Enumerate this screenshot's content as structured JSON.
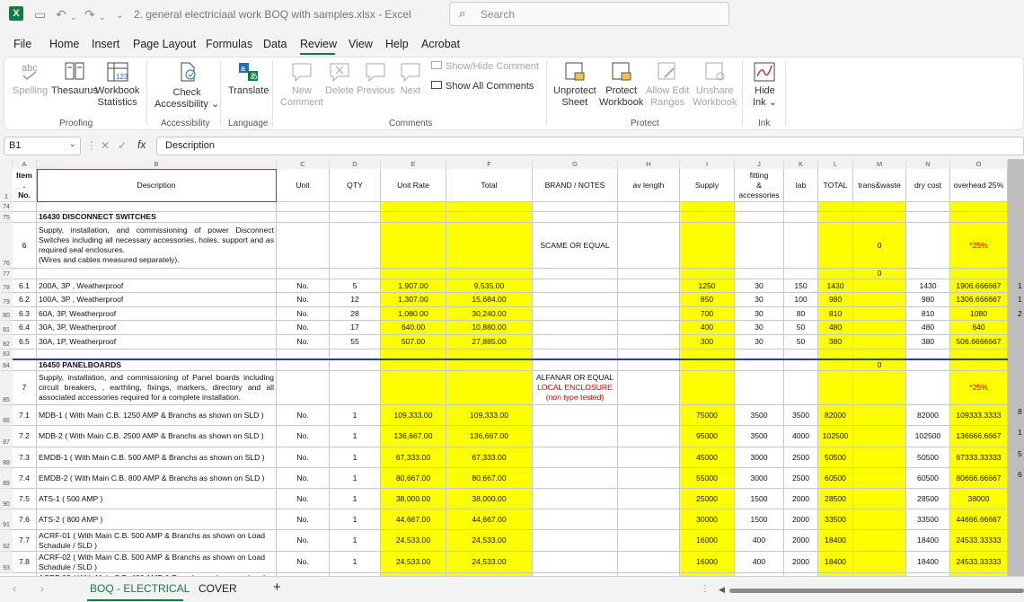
{
  "title": {
    "doc_name": "2. general electriciaal work BOQ with samples.xlsx  -  Excel",
    "search_placeholder": "Search"
  },
  "menu": [
    "File",
    "Home",
    "Insert",
    "Page Layout",
    "Formulas",
    "Data",
    "Review",
    "View",
    "Help",
    "Acrobat"
  ],
  "ribbon": {
    "spelling": "Spelling",
    "thesaurus": "Thesaurus",
    "workbook_stats": [
      "Workbook",
      "Statistics"
    ],
    "check_access": [
      "Check",
      "Accessibility ⌄"
    ],
    "translate": "Translate",
    "new_comment": [
      "New",
      "Comment"
    ],
    "delete": "Delete",
    "previous": "Previous",
    "next": "Next",
    "show_hide_comment": "Show/Hide Comment",
    "show_all_comments": "Show All Comments",
    "unprotect_sheet": [
      "Unprotect",
      "Sheet"
    ],
    "protect_workbook": [
      "Protect",
      "Workbook"
    ],
    "allow_edit_ranges": [
      "Allow Edit",
      "Ranges"
    ],
    "unshare_workbook": [
      "Unshare",
      "Workbook"
    ],
    "hide_ink": [
      "Hide",
      "Ink ⌄"
    ],
    "groups": {
      "proofing": "Proofing",
      "accessibility": "Accessibility",
      "language": "Language",
      "comments": "Comments",
      "protect": "Protect",
      "ink": "Ink"
    }
  },
  "formula_bar": {
    "name_box": "B1",
    "fx": "fx",
    "content": "Description"
  },
  "columns": [
    "A",
    "B",
    "C",
    "D",
    "E",
    "F",
    "G",
    "H",
    "I",
    "J",
    "K",
    "L",
    "M",
    "N",
    "O"
  ],
  "header": {
    "item": [
      "Item",
      ".",
      "No."
    ],
    "description": "Description",
    "unit": "Unit",
    "qty": "QTY",
    "unit_rate": "Unit Rate",
    "total": "Total",
    "brand": "BRAND / NOTES",
    "av_length": "av length",
    "supply": "Supply",
    "fitting": [
      "fitting",
      "&",
      "accessories"
    ],
    "lab": "lab",
    "total2": "TOTAL",
    "trans": "trans&waste",
    "dry_cost": "dry cost",
    "overhead": "overhead 25%"
  },
  "row_numbers": [
    "1",
    "74",
    "75",
    "76",
    "77",
    "78",
    "79",
    "80",
    "81",
    "82",
    "83",
    "84",
    "85",
    "86",
    "87",
    "88",
    "89",
    "90",
    "91",
    "92",
    "93"
  ],
  "sections": {
    "s1_title": "16430 DISCONNECT SWITCHES",
    "s1_item": "6",
    "s1_desc": "Supply, installation, and commissioning of power Disconnect Switches including all necessary accessories, holes, support and as required seal enclosures.",
    "s1_desc2": "(Wires and cables measured separately).",
    "s1_brand": "SCAME OR EQUAL",
    "s1_trans": "0",
    "s1_overhead": "*25%",
    "r77_trans": "0",
    "s2_title": "16450 PANELBOARDS",
    "s2_trans": "0",
    "s2_item": "7",
    "s2_desc": "Supply, installation, and commissioning of Panel boards including circuit breakers, , earthling, fixings, markers, directory and all associated accessories required for a complete installation.",
    "s2_brand1": "ALFANAR OR EQUAL",
    "s2_brand2": "LOCAL ENCLOSURE (non type tested)",
    "s2_overhead": "*25%"
  },
  "rows_a": [
    {
      "no": "6.1",
      "desc": "200A, 3P , Weatherproof",
      "unit": "No.",
      "qty": "5",
      "rate": "1,907.00",
      "total": "9,535.00",
      "supply": "1250",
      "fit": "30",
      "lab": "150",
      "tot": "1430",
      "dry": "1430",
      "oh": "1906.666667"
    },
    {
      "no": "6.2",
      "desc": "100A, 3P , Weatherproof",
      "unit": "No.",
      "qty": "12",
      "rate": "1,307.00",
      "total": "15,684.00",
      "supply": "850",
      "fit": "30",
      "lab": "100",
      "tot": "980",
      "dry": "980",
      "oh": "1306.666667"
    },
    {
      "no": "6.3",
      "desc": "60A, 3P, Weatherproof",
      "unit": "No.",
      "qty": "28",
      "rate": "1,080.00",
      "total": "30,240.00",
      "supply": "700",
      "fit": "30",
      "lab": "80",
      "tot": "810",
      "dry": "810",
      "oh": "1080"
    },
    {
      "no": "6.4",
      "desc": "30A, 3P, Weatherproof",
      "unit": "No.",
      "qty": "17",
      "rate": "640.00",
      "total": "10,880.00",
      "supply": "400",
      "fit": "30",
      "lab": "50",
      "tot": "480",
      "dry": "480",
      "oh": "640"
    },
    {
      "no": "6.5",
      "desc": "30A, 1P, Weatherproof",
      "unit": "No.",
      "qty": "55",
      "rate": "507.00",
      "total": "27,885.00",
      "supply": "300",
      "fit": "30",
      "lab": "50",
      "tot": "380",
      "dry": "380",
      "oh": "506.6666667"
    }
  ],
  "rows_b": [
    {
      "no": "7.1",
      "desc": "MDB-1 ( With Main C.B. 1250 AMP & Branchs as shown on SLD )",
      "unit": "No.",
      "qty": "1",
      "rate": "109,333.00",
      "total": "109,333.00",
      "supply": "75000",
      "fit": "3500",
      "lab": "3500",
      "tot": "82000",
      "dry": "82000",
      "oh": "109333.3333"
    },
    {
      "no": "7.2",
      "desc": "MDB-2 ( With Main C.B. 2500 AMP & Branchs as shown on SLD )",
      "unit": "No.",
      "qty": "1",
      "rate": "136,667.00",
      "total": "136,667.00",
      "supply": "95000",
      "fit": "3500",
      "lab": "4000",
      "tot": "102500",
      "dry": "102500",
      "oh": "136666.6667"
    },
    {
      "no": "7.3",
      "desc": "EMDB-1 ( With Main C.B. 500 AMP & Branchs as shown on SLD )",
      "unit": "No.",
      "qty": "1",
      "rate": "67,333.00",
      "total": "67,333.00",
      "supply": "45000",
      "fit": "3000",
      "lab": "2500",
      "tot": "50500",
      "dry": "50500",
      "oh": "67333.33333"
    },
    {
      "no": "7.4",
      "desc": "EMDB-2 ( With Main C.B. 800 AMP & Branchs as shown on SLD )",
      "unit": "No.",
      "qty": "1",
      "rate": "80,667.00",
      "total": "80,667.00",
      "supply": "55000",
      "fit": "3000",
      "lab": "2500",
      "tot": "60500",
      "dry": "60500",
      "oh": "80666.66667"
    },
    {
      "no": "7.5",
      "desc": "ATS-1 ( 500 AMP )",
      "unit": "No.",
      "qty": "1",
      "rate": "38,000.00",
      "total": "38,000.00",
      "supply": "25000",
      "fit": "1500",
      "lab": "2000",
      "tot": "28500",
      "dry": "28500",
      "oh": "38000"
    },
    {
      "no": "7.6",
      "desc": "ATS-2 ( 800 AMP )",
      "unit": "No.",
      "qty": "1",
      "rate": "44,667.00",
      "total": "44,667.00",
      "supply": "30000",
      "fit": "1500",
      "lab": "2000",
      "tot": "33500",
      "dry": "33500",
      "oh": "44666.66667"
    },
    {
      "no": "7.7",
      "desc": "ACRF-01 ( With Main C.B. 500 AMP & Branchs as shown on Load Schadule / SLD )",
      "unit": "No.",
      "qty": "1",
      "rate": "24,533.00",
      "total": "24,533.00",
      "supply": "16000",
      "fit": "400",
      "lab": "2000",
      "tot": "18400",
      "dry": "18400",
      "oh": "24533.33333"
    },
    {
      "no": "7.8",
      "desc": "ACRF-02 ( With Main C.B. 500 AMP & Branchs as shown on Load Schadule / SLD )",
      "unit": "No.",
      "qty": "1",
      "rate": "24,533.00",
      "total": "24,533.00",
      "supply": "16000",
      "fit": "400",
      "lab": "2000",
      "tot": "18400",
      "dry": "18400",
      "oh": "24533.33333"
    }
  ],
  "edge_digits": [
    "1",
    "1",
    "2",
    "",
    "",
    "8",
    "1",
    "5",
    "6",
    "",
    "",
    "",
    ""
  ],
  "partial_row": "ACRF-03 ( With Main C.B. 400 AMP & Branchs as shown on Load",
  "sheet_tabs": [
    "BOQ - ELECTRICAL",
    "COVER"
  ],
  "colors": {
    "yellow": "#ffff00",
    "excel_green": "#107c41",
    "red": "#e00000"
  }
}
